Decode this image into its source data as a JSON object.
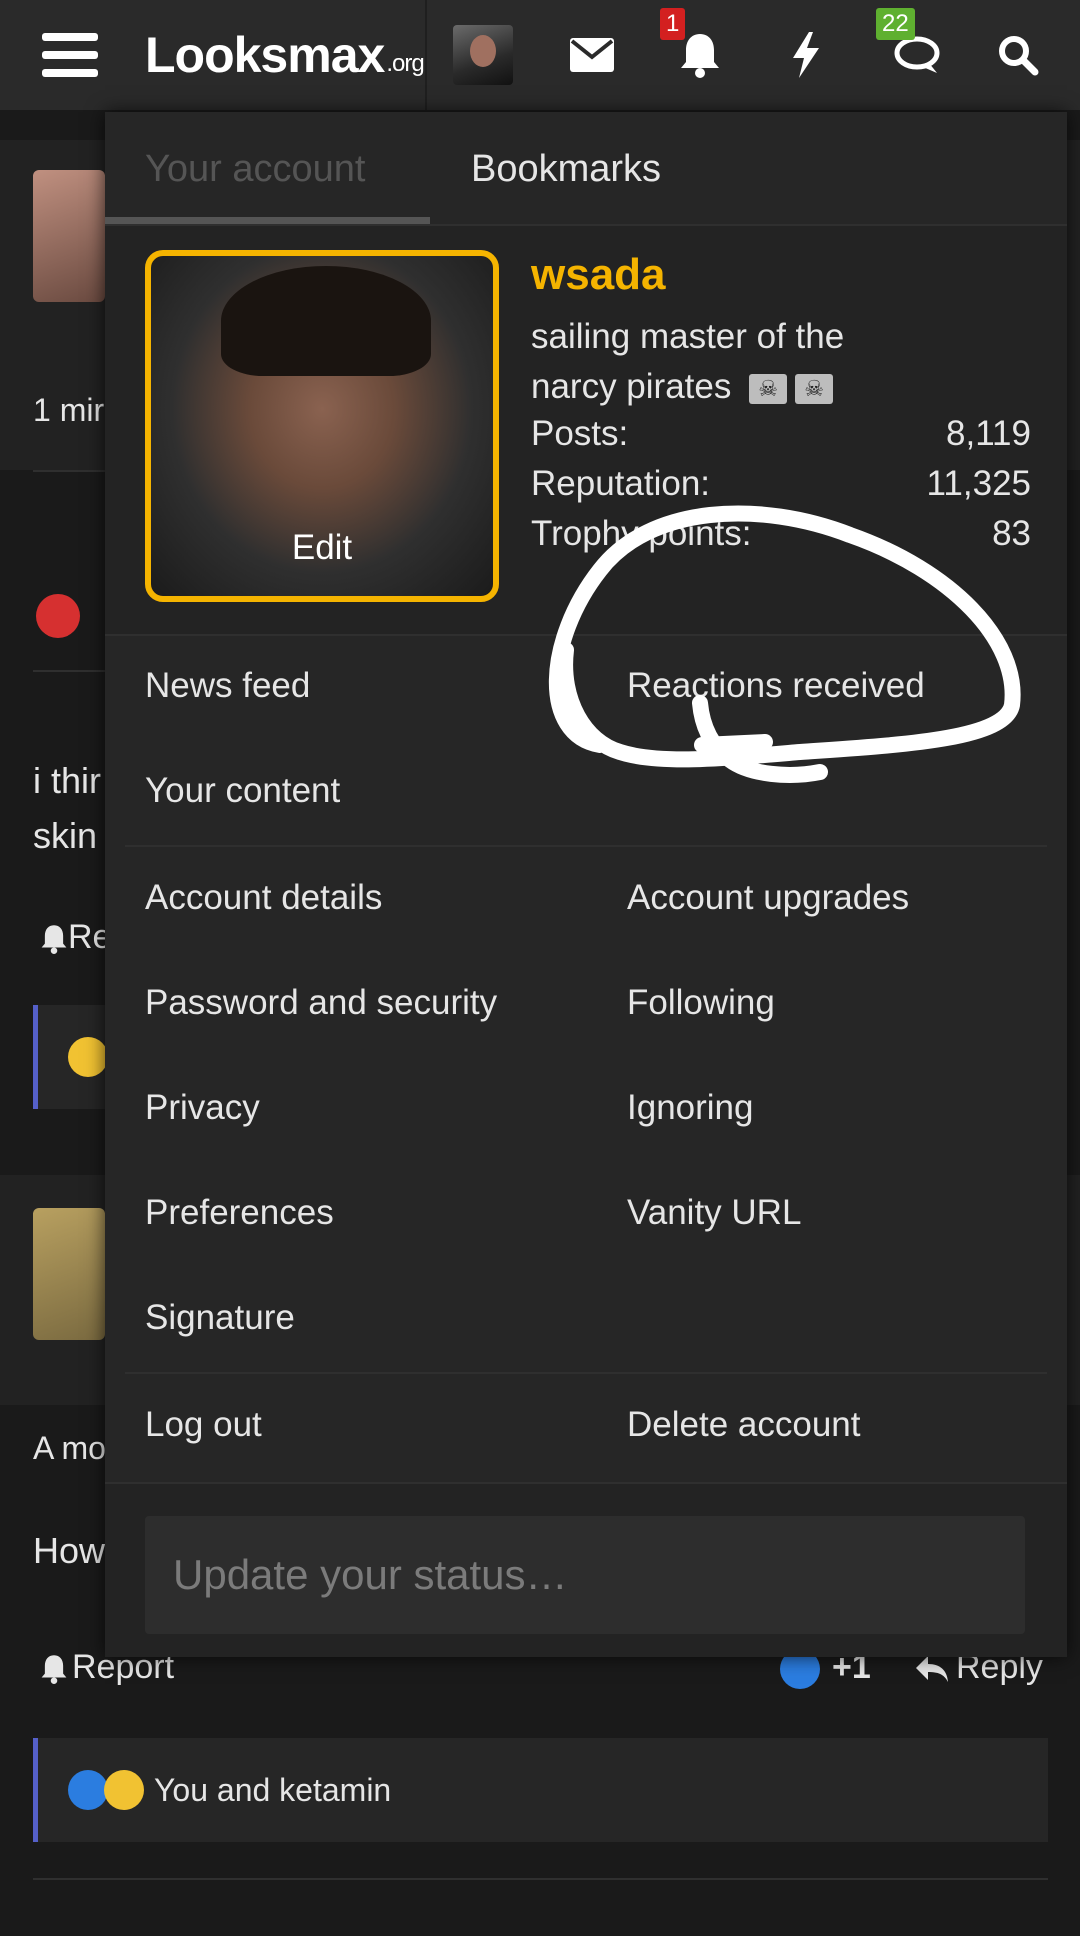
{
  "header": {
    "logo_main": "Looksmax",
    "logo_suffix": ".org",
    "alerts_badge": "1",
    "conversations_badge": "22"
  },
  "background_page": {
    "post1_time": "1 mir",
    "post1_snippet_line1": "i thir",
    "post1_snippet_line2": "skin",
    "post1_report_partial": "Re",
    "post2_snippet1": "A mo",
    "post2_snippet2": "How",
    "report_label": "Report",
    "like_count": "+1",
    "reply_label": "Reply",
    "reactions_summary": "You and ketamin"
  },
  "dropdown": {
    "tabs": [
      {
        "label": "Your account",
        "active": false
      },
      {
        "label": "Bookmarks",
        "active": true
      }
    ],
    "profile": {
      "edit_label": "Edit",
      "username": "wsada",
      "user_title": "sailing master of the narcy pirates",
      "flag_symbol": "☠",
      "stats": [
        {
          "label": "Posts:",
          "value": "8,119"
        },
        {
          "label": "Reputation:",
          "value": "11,325"
        },
        {
          "label": "Trophy points:",
          "value": "83"
        }
      ]
    },
    "menu": {
      "news_feed": "News feed",
      "reactions_received": "Reactions received",
      "your_content": "Your content",
      "account_details": "Account details",
      "account_upgrades": "Account upgrades",
      "password_security": "Password and security",
      "following": "Following",
      "privacy": "Privacy",
      "ignoring": "Ignoring",
      "preferences": "Preferences",
      "vanity_url": "Vanity URL",
      "signature": "Signature",
      "log_out": "Log out",
      "delete_account": "Delete account"
    },
    "status_placeholder": "Update your status…"
  },
  "colors": {
    "accent_gold": "#f5b400",
    "panel_bg": "#262626",
    "topbar_bg": "#2a2a2a",
    "alert_red": "#d32020",
    "conversation_green": "#5fb030",
    "quote_bar": "#5560c9"
  },
  "icons": [
    "menu-icon",
    "envelope-icon",
    "bell-icon",
    "lightning-icon",
    "conversations-icon",
    "search-icon"
  ]
}
